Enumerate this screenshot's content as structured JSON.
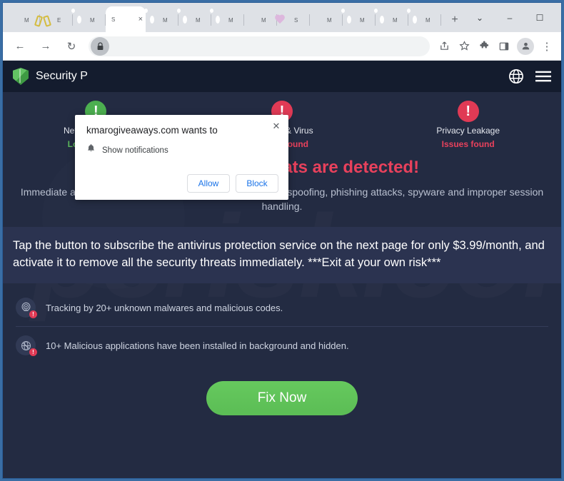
{
  "browser": {
    "tabs": [
      {
        "favicon": "shield-icon",
        "title": "M",
        "active": false
      },
      {
        "favicon": "scissors-icon",
        "title": "E",
        "active": false
      },
      {
        "favicon": "globe-icon",
        "title": "M",
        "active": false
      },
      {
        "favicon": "none",
        "title": "S",
        "active": true,
        "close": "×"
      },
      {
        "favicon": "globe-icon",
        "title": "M",
        "active": false
      },
      {
        "favicon": "globe-icon",
        "title": "M",
        "active": false
      },
      {
        "favicon": "globe-icon",
        "title": "M",
        "active": false
      },
      {
        "favicon": "shield-icon",
        "title": "M",
        "active": false
      },
      {
        "favicon": "heart-icon",
        "title": "S",
        "active": false
      },
      {
        "favicon": "shield-icon",
        "title": "M",
        "active": false
      },
      {
        "favicon": "globe-icon",
        "title": "M",
        "active": false
      },
      {
        "favicon": "globe-icon",
        "title": "M",
        "active": false
      },
      {
        "favicon": "globe-icon",
        "title": "M",
        "active": false
      }
    ],
    "new_tab_label": "+",
    "window_controls": {
      "tab_search": "⌄",
      "minimize": "–",
      "maximize": "☐",
      "close": "✕"
    },
    "toolbar": {
      "back": "←",
      "forward": "→",
      "reload": "↻",
      "lock": "lock-icon",
      "url": "",
      "share": "share-icon",
      "bookmark": "star-icon",
      "extensions": "puzzle-icon",
      "side_panel": "side-panel-icon",
      "profile": "avatar-icon",
      "menu": "⋮"
    }
  },
  "permission_dialog": {
    "title": "kmarogiveaways.com wants to",
    "option_icon": "bell-icon",
    "option_label": "Show notifications",
    "allow_label": "Allow",
    "block_label": "Block",
    "close_label": "✕"
  },
  "site": {
    "logo": "shield-icon",
    "title": "Security P",
    "globe_icon": "globe-icon",
    "menu_icon": "hamburger-icon",
    "status_items": [
      {
        "badge": "!",
        "badge_type": "ok",
        "name": "Network Security",
        "state": "Looking good",
        "state_type": "good"
      },
      {
        "badge": "!",
        "badge_type": "danger",
        "name": "Malware & Virus",
        "state": "Issues found",
        "state_type": "bad"
      },
      {
        "badge": "!",
        "badge_type": "danger",
        "name": "Privacy Leakage",
        "state": "Issues found",
        "state_type": "bad"
      }
    ],
    "headline": "(28) security threats are detected!",
    "subline": "Immediate action is required to avoid data leakage, network spoofing, phishing attacks, spyware and improper session handling.",
    "promo": "Tap the button to subscribe the antivirus protection service on the next page for only $3.99/month, and activate it to remove all the security threats immediately. ***Exit at your own risk***",
    "threats": [
      {
        "icon": "radar-icon",
        "text": "Tracking by 20+ unknown malwares and malicious codes.",
        "warn": "!"
      },
      {
        "icon": "blocked-app-icon",
        "text": "10+ Malicious applications have been installed in background and hidden.",
        "warn": "!"
      }
    ],
    "fix_button": "Fix Now",
    "watermark": "pcrisk.com"
  },
  "colors": {
    "page_bg": "#232b42",
    "header_bg": "#141c2e",
    "accent_red": "#e8415c",
    "accent_green": "#5bbd55",
    "promo_bg": "#2b3350",
    "link_blue": "#1a73e8"
  }
}
